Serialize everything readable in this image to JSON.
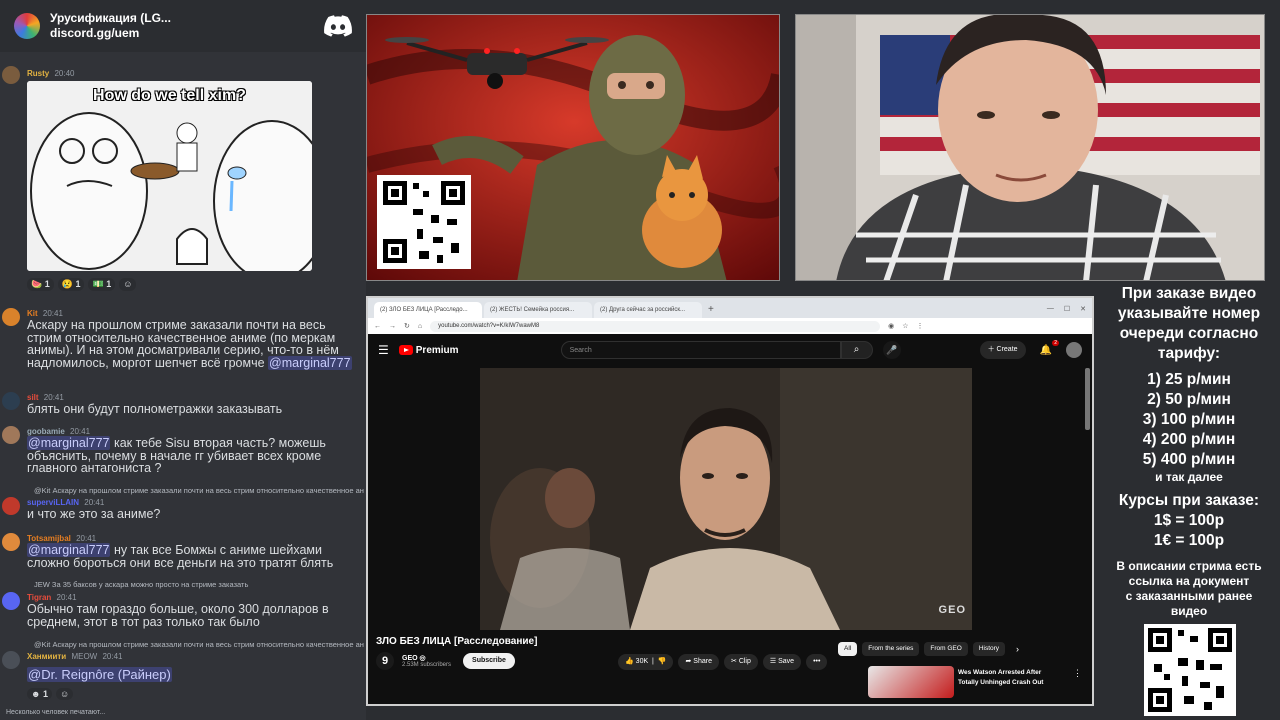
{
  "discord": {
    "server_name": "Урусификация (LG...",
    "server_link": "discord.gg/uem",
    "meme_caption": "How do we tell xim?",
    "meme_reactions": [
      "1",
      "1",
      "1"
    ],
    "messages": [
      {
        "author": "Rusty",
        "time": "20:40"
      },
      {
        "author": "Kit",
        "time": "20:41",
        "text": "Аскару на прошлом стриме заказали почти на весь стрим относительно качественное аниме (по меркам анимы). И на этом досматривали серию, что-то в нём надломилось, моргот шепчет всё громче",
        "mention": "@marginal777"
      },
      {
        "author": "silt",
        "time": "20:41",
        "text": "блять они будут полнометражки заказывать"
      },
      {
        "author": "goobamie",
        "time": "20:41",
        "mention": "@marginal777",
        "text": " как тебе Sisu вторая часть? можешь объяснить, почему в начале гг убивает всех кроме главного антагониста ?"
      },
      {
        "reply": "@Kit Аскару на прошлом стриме заказали почти на весь стрим относительно качественное аниме...",
        "author": "superviLLAIN",
        "time": "20:41",
        "text": "и что же это за аниме?"
      },
      {
        "author": "Totsamijbal",
        "time": "20:41",
        "mention": "@marginal777",
        "text": " ну так все Бомжы с аниме шейхами сложно бороться они все деньги на это тратят блять"
      },
      {
        "reply": "JEW  За 35 баксов у аскара можно просто на стриме заказать",
        "author": "Tigran",
        "time": "20:41",
        "text": "Обычно там гораздо больше, около 300 долларов в среднем, этот в тот раз только так было"
      },
      {
        "reply": "@Kit Аскару на прошлом стриме заказали почти на весь стрим относительно качественное аниме",
        "author": "Ханмиити",
        "tag": "MEOW",
        "time": "20:41",
        "mention": "@Dr. Reignôre (Райнер)"
      }
    ],
    "last_reactions": [
      "1"
    ],
    "typing": "Несколько человек печатают..."
  },
  "browser": {
    "tabs": [
      "(2) ЗЛО БЕЗ ЛИЦА [Расследо...",
      "(2) ЖЕСТЬ! Семейка россия...",
      "(2) Дрyга сейчас за российск..."
    ],
    "url": "youtube.com/watch?v=K/kIW7wawM8",
    "yt_logo": "Premium",
    "search_placeholder": "Search",
    "create_label": "Create",
    "notif_count": "2",
    "watermark": "GEO",
    "video_title": "ЗЛО БЕЗ ЛИЦА [Расследование]",
    "channel_logo": "9",
    "channel_name": "GEO",
    "subscribers": "2.53M subscribers",
    "subscribe_label": "Subscribe",
    "likes": "30K",
    "share_label": "Share",
    "clip_label": "Clip",
    "save_label": "Save",
    "chips": [
      "All",
      "From the series",
      "From GEO",
      "History"
    ],
    "rec_title": "Wes Watson Arrested After Totally Unhinged Crash Out"
  },
  "info": {
    "line1": "При заказе видео",
    "line2": "указывайте номер",
    "line3": "очереди согласно",
    "line4": "тарифу:",
    "tariffs": [
      "1) 25 р/мин",
      "2) 50 р/мин",
      "3) 100 р/мин",
      "4) 200 р/мин",
      "5) 400 р/мин"
    ],
    "etc": "и так далее",
    "rates_title": "Курсы при заказе:",
    "rate_usd": "1$ = 100р",
    "rate_eur": "1€ = 100р",
    "desc1": "В описании стрима есть",
    "desc2": "ссылка на документ",
    "desc3": "с заказанными ранее",
    "desc4": "видео"
  },
  "colors": {
    "discord_bg": "#313338",
    "mention": "#c9cdfb",
    "yt_red": "#ff0000"
  }
}
